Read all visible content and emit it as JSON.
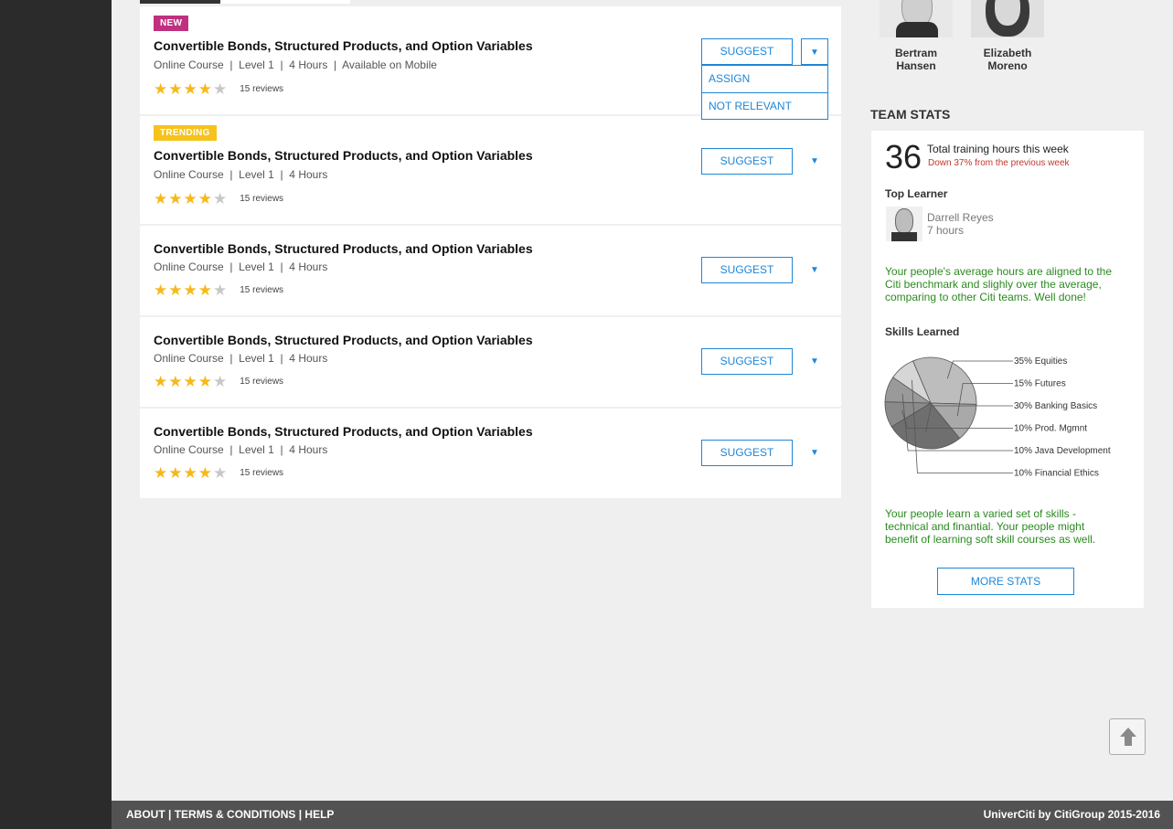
{
  "courses": [
    {
      "badge": "NEW",
      "title": "Convertible Bonds, Structured Products, and Option Variables",
      "meta": "Online Course  |  Level 1  |  4 Hours  |  Available on Mobile",
      "rating": 4,
      "reviews": "15 reviews",
      "suggest": "SUGGEST"
    },
    {
      "badge": "TRENDING",
      "title": "Convertible Bonds, Structured Products, and Option Variables",
      "meta": "Online Course  |  Level 1  |  4 Hours",
      "rating": 4,
      "reviews": "15 reviews",
      "suggest": "SUGGEST"
    },
    {
      "title": "Convertible Bonds, Structured Products, and Option Variables",
      "meta": "Online Course  |  Level 1  |  4 Hours",
      "rating": 4,
      "reviews": "15 reviews",
      "suggest": "SUGGEST"
    },
    {
      "title": "Convertible Bonds, Structured Products, and Option Variables",
      "meta": "Online Course  |  Level 1  |  4 Hours",
      "rating": 4,
      "reviews": "15 reviews",
      "suggest": "SUGGEST"
    },
    {
      "title": "Convertible Bonds, Structured Products, and Option Variables",
      "meta": "Online Course  |  Level 1  |  4 Hours",
      "rating": 4,
      "reviews": "15 reviews",
      "suggest": "SUGGEST"
    }
  ],
  "dropdown": {
    "assign": "ASSIGN",
    "not_relevant": "NOT RELEVANT"
  },
  "team": {
    "members": [
      {
        "first": "Bertram",
        "last": "Hansen"
      },
      {
        "first": "Elizabeth",
        "last": "Moreno"
      }
    ],
    "heading": "TEAM STATS"
  },
  "stats": {
    "hours": "36",
    "hours_label": "Total training hours this week",
    "trend": "Down 37% from the previous week",
    "top_learner_heading": "Top Learner",
    "top_learner_name": "Darrell Reyes",
    "top_learner_hours": "7 hours",
    "benchmark_msg": "Your people's average hours are aligned to the Citi benchmark and slighly over the average, comparing to other Citi teams. Well done!",
    "skills_heading": "Skills Learned",
    "skills_msg": "Your people learn a varied set of skills - technical and finantial. Your people might benefit of learning soft skill courses as well.",
    "more_stats": "MORE STATS"
  },
  "chart_data": {
    "type": "pie",
    "title": "Skills Learned",
    "labels": [
      "35% Equities",
      "15% Futures",
      "30% Banking Basics",
      "10% Prod. Mgmnt",
      "10% Java Development",
      "10% Financial Ethics"
    ],
    "values": [
      35,
      15,
      30,
      10,
      10,
      10
    ],
    "colors": [
      "#bdbdbd",
      "#a9a9a9",
      "#6f6f6f",
      "#8a8a8a",
      "#9a9a9a",
      "#d6d6d6"
    ]
  },
  "footer": {
    "about": "ABOUT",
    "terms": "TERMS & CONDITIONS",
    "help": "HELP",
    "copyright": "UniverCiti by CitiGroup 2015-2016"
  },
  "icons": {
    "star": "star-icon",
    "caret": "caret-down-icon",
    "scroll": "arrow-up-icon"
  }
}
